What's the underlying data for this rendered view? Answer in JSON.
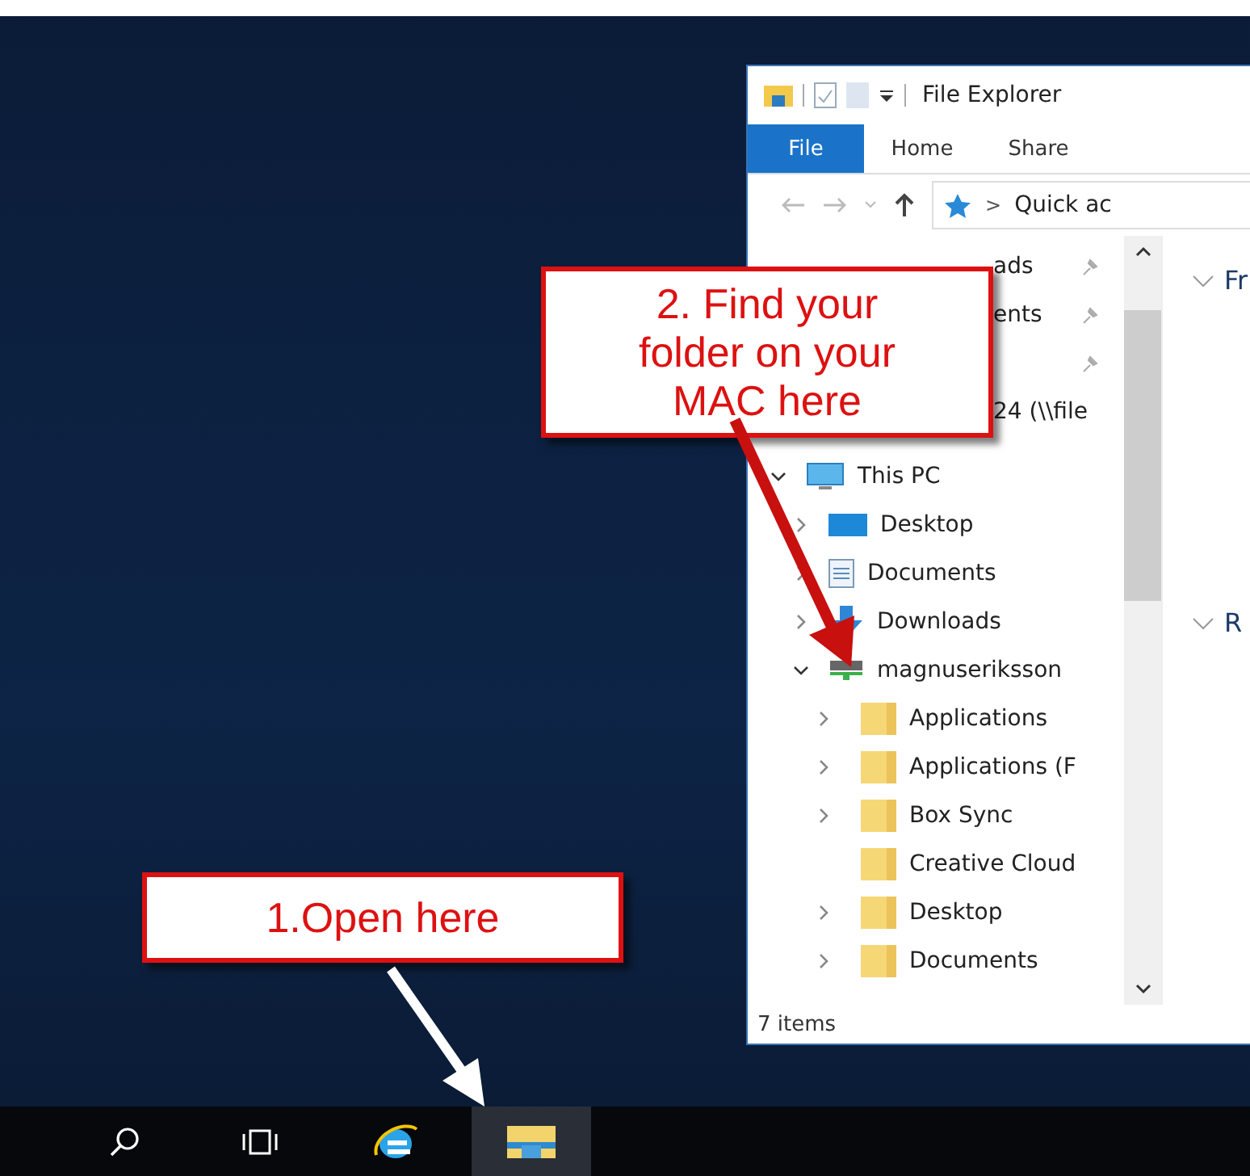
{
  "explorer": {
    "title": "File Explorer",
    "tabs": [
      {
        "label": "File",
        "selected": true
      },
      {
        "label": "Home",
        "selected": false
      },
      {
        "label": "Share",
        "selected": false
      }
    ],
    "address": {
      "crumb_separator": ">",
      "path": "Quick ac"
    },
    "quick_access": [
      {
        "label": "ads",
        "pinned": true
      },
      {
        "label": "ents",
        "pinned": true
      },
      {
        "pinned": true
      },
      {
        "label": "24 (\\\\file",
        "pinned": false
      }
    ],
    "tree": [
      {
        "label": "This PC",
        "kind": "pc",
        "expanded": true,
        "children": [
          {
            "label": "Desktop",
            "kind": "desktop",
            "expanded": false
          },
          {
            "label": "Documents",
            "kind": "documents",
            "expanded": false
          },
          {
            "label": "Downloads",
            "kind": "downloads",
            "expanded": false
          },
          {
            "label": "magnuseriksson",
            "kind": "drive",
            "expanded": true,
            "children": [
              {
                "label": "Applications",
                "kind": "folder",
                "expanded": false
              },
              {
                "label": "Applications (F",
                "kind": "folder",
                "expanded": false
              },
              {
                "label": "Box Sync",
                "kind": "folder",
                "expanded": false
              },
              {
                "label": "Creative Cloud",
                "kind": "folder"
              },
              {
                "label": "Desktop",
                "kind": "folder",
                "expanded": false
              },
              {
                "label": "Documents",
                "kind": "folder",
                "expanded": false
              }
            ]
          }
        ]
      }
    ],
    "content_groups": [
      {
        "label": "Fr"
      },
      {
        "label": "R"
      }
    ],
    "status": "7 items"
  },
  "callouts": [
    {
      "text": "2. Find your folder on your MAC here"
    },
    {
      "text": "1.Open here"
    }
  ],
  "taskbar": [
    {
      "kind": "search",
      "active": false
    },
    {
      "kind": "task-view",
      "active": false
    },
    {
      "kind": "browser",
      "active": false
    },
    {
      "kind": "explorer",
      "active": true
    }
  ]
}
